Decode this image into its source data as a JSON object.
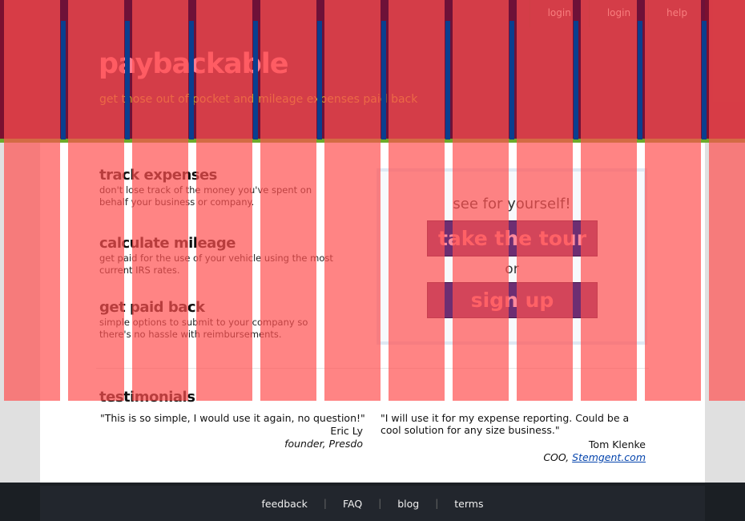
{
  "nav": {
    "items": [
      "login",
      "login",
      "help"
    ]
  },
  "brand": {
    "logo": "paybackable",
    "tagline": "get those out of pocket and mileage expenses paid back"
  },
  "features": [
    {
      "title": "track expenses",
      "text": "don't lose track of the money you've spent on behalf your business or company."
    },
    {
      "title": "calculate mileage",
      "text": "get paid for the use of your vehicle using the most current IRS rates."
    },
    {
      "title": "get paid back",
      "text": "simple options to submit to your company so there's no hassle with reimbursements."
    }
  ],
  "cta": {
    "heading": "see for yourself!",
    "tour": "take the tour",
    "or": "or",
    "signup": "sign up"
  },
  "testimonials": {
    "heading": "testimonials",
    "items": [
      {
        "quote": "\"This is so simple, I would use it again, no question!\"",
        "name": "Eric Ly",
        "role": "founder, Presdo"
      },
      {
        "quote": "\"I will use it for my expense reporting. Could be a cool solution for any size business.\"",
        "name": "Tom Klenke",
        "role_prefix": "COO, ",
        "company": "Stemgent.com"
      }
    ]
  },
  "footer": {
    "links": [
      "feedback",
      "FAQ",
      "blog",
      "terms"
    ],
    "separator": "|"
  },
  "colors": {
    "header": "#6e1138",
    "accent": "#ff7a8f",
    "tagline": "#c0a22e",
    "button": "#6d2e72",
    "footer": "#22262d"
  }
}
